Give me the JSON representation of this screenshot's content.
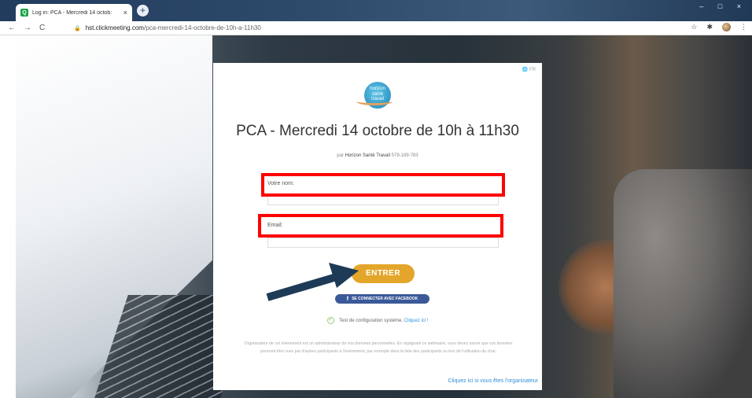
{
  "browser": {
    "tab_title": "Log in: PCA - Mercredi 14 octob:",
    "tab_close": "×",
    "favicon": "Q",
    "new_tab": "+",
    "url_domain": "hst.clickmeeting.com",
    "url_path": "/pca-mercredi-14-octobre-de-10h-a-11h30",
    "nav_back": "←",
    "nav_forward": "→",
    "nav_reload": "C",
    "lock": "🔒",
    "tools": {
      "star": "☆",
      "puzzle": "✱",
      "menu": "⋮"
    },
    "window_controls": "– □ ×"
  },
  "page": {
    "lang": "🌐 FR",
    "logo_text": [
      "horizon",
      "santé",
      "travail"
    ],
    "title": "PCA - Mercredi 14 octobre de 10h à 11h30",
    "byline_prefix": "par",
    "organizer": "Horizon Santé Travail",
    "event_id": "579-189-783",
    "name_label": "Votre nom:",
    "email_label": "Email:",
    "enter_button": "ENTRER",
    "facebook_icon": "f",
    "facebook_button": "SE CONNECTER AVEC FACEBOOK",
    "systest_icon": "✓",
    "systest_text": "Test de configuration système.",
    "systest_link": "Cliquez ici !",
    "disclaimer": "Organisateur de cet événement est un administrateur de vos données personnelles. En rejoignant ce webinaire, vous devez savoir que vos données pourront être vues par d'autres participants à l'événement, par exemple dans la liste des participants ou lors de l'utilisation du chat.",
    "organizer_link": "Cliquez ici si vous êtes l'organisateur"
  },
  "annotations": {
    "highlight_color": "#ff0000",
    "arrow_color": "#1d3a57"
  }
}
